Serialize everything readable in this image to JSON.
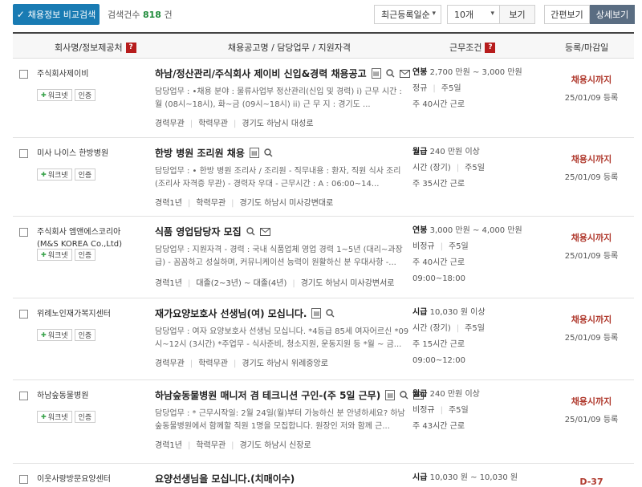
{
  "toolbar": {
    "compare_label": "채용정보 비교검색",
    "count_label": "검색건수",
    "count_value": "818",
    "count_unit": "건",
    "sort_value": "최근등록일순",
    "page_size_value": "10개",
    "view_button": "보기",
    "simple_view": "간편보기",
    "detail_view": "상세보기"
  },
  "table": {
    "headers": {
      "company": "회사명/정보제공처",
      "posting": "채용공고명 / 담당업무 / 지원자격",
      "conditions": "근무조건",
      "deadline": "등록/마감일"
    },
    "rows": [
      {
        "company": "주식회사제이비",
        "badges": [
          "워크넷",
          "인증"
        ],
        "title": "하남/정산관리/주식회사 제이비 신입&경력 채용공고",
        "desc": "담당업무 : •채용 분야 : 물류사업부 정산관리(신입 및 경력) i) 근무 시간 : 월 (08시~18시), 화~금 (09시~18시) ii) 근 무 지 : 경기도 ...",
        "meta": [
          "경력무관",
          "학력무관",
          "경기도 하남시 대성로"
        ],
        "pay_type": "연봉",
        "pay": "2,700 만원 ~ 3,000 만원",
        "cond2": [
          "정규",
          "주5일"
        ],
        "cond3": "주 40시간 근로",
        "cond4": "",
        "deadline": "채용시까지",
        "regdate": "25/01/09 등록"
      },
      {
        "company": "미사 나이스 한방병원",
        "badges": [
          "워크넷",
          "인증"
        ],
        "title": "한방 병원 조리원 채용",
        "desc": "담당업무 : • 한방 병원 조리사 / 조리원 - 직무내용 : 환자, 직원 식사 조리 (조리사 자격증 무관) - 경력자 우대 - 근무시간 : A : 06:00~14...",
        "meta": [
          "경력1년",
          "학력무관",
          "경기도 하남시 미사강변대로"
        ],
        "pay_type": "월급",
        "pay": "240 만원 이상",
        "cond2": [
          "시간 (장기)",
          "주5일"
        ],
        "cond3": "주 35시간 근로",
        "cond4": "",
        "deadline": "채용시까지",
        "regdate": "25/01/09 등록"
      },
      {
        "company": "주식회사 엠앤에스코리아(M&S KOREA Co.,Ltd)",
        "badges": [
          "워크넷",
          "인증"
        ],
        "title": "식품 영업담당자 모집",
        "desc": "담당업무 : 지원자격 - 경력 : 국내 식품업체 영업 경력 1~5년 (대리~과장급) - 꼼꼼하고 성실하며, 커뮤니케이션 능력이 원활하신 분 우대사항 -...",
        "meta": [
          "경력1년",
          "대졸(2~3년) ~ 대졸(4년)",
          "경기도 하남시 미사강변서로"
        ],
        "pay_type": "연봉",
        "pay": "3,000 만원 ~ 4,000 만원",
        "cond2": [
          "비정규",
          "주5일"
        ],
        "cond3": "주 40시간 근로",
        "cond4": "09:00~18:00",
        "deadline": "채용시까지",
        "regdate": "25/01/09 등록"
      },
      {
        "company": "위례노인재가복지센터",
        "badges": [
          "워크넷",
          "인증"
        ],
        "title": "재가요양보호사 선생님(여) 모십니다.",
        "desc": "담당업무 : 여자 요양보호사 선생님 모십니다. *4등급 85세 여자어르신 *09시~12시 (3시간) *주업무 - 식사준비, 청소지원, 운동지원 등 *월 ~ 금...",
        "meta": [
          "경력무관",
          "학력무관",
          "경기도 하남시 위례중앙로"
        ],
        "pay_type": "시급",
        "pay": "10,030 원 이상",
        "cond2": [
          "시간 (장기)",
          "주5일"
        ],
        "cond3": "주 15시간 근로",
        "cond4": "09:00~12:00",
        "deadline": "채용시까지",
        "regdate": "25/01/09 등록"
      },
      {
        "company": "하남숲동물병원",
        "badges": [
          "워크넷",
          "인증"
        ],
        "title": "하남숲동물병원 매니저 겸 테크니션 구인-(주 5일 근무)",
        "desc": "담당업무 : * 근무시작일: 2월 24일(월)부터 가능하신 분 안녕하세요? 하남숲동물병원에서 함께할 직원 1명을 모집합니다. 원장인 저와 함께 근...",
        "meta": [
          "경력1년",
          "학력무관",
          "경기도 하남시 신장로"
        ],
        "pay_type": "월급",
        "pay": "240 만원 이상",
        "cond2": [
          "비정규",
          "주5일"
        ],
        "cond3": "주 43시간 근로",
        "cond4": "",
        "deadline": "채용시까지",
        "regdate": "25/01/09 등록"
      },
      {
        "company": "이웃사랑방문요양센터",
        "badges": [],
        "title": "요양선생님을 모십니다.(치매이수)",
        "desc": "",
        "meta": [],
        "pay_type": "시급",
        "pay": "10,030 원 ~ 10,030 원",
        "cond2": [],
        "cond3": "",
        "cond4": "",
        "deadline": "D-37",
        "regdate": ""
      }
    ]
  },
  "colors": {
    "primary_button": "#197bb3",
    "count_green": "#1f8b3a",
    "deadline_red": "#b03a2e",
    "help_badge": "#b71c1c",
    "detail_toggle": "#5a6d82"
  },
  "icons": [
    "check-icon",
    "caret-down-icon",
    "help-icon",
    "document-icon",
    "search-icon",
    "mail-icon",
    "worknet-icon"
  ]
}
